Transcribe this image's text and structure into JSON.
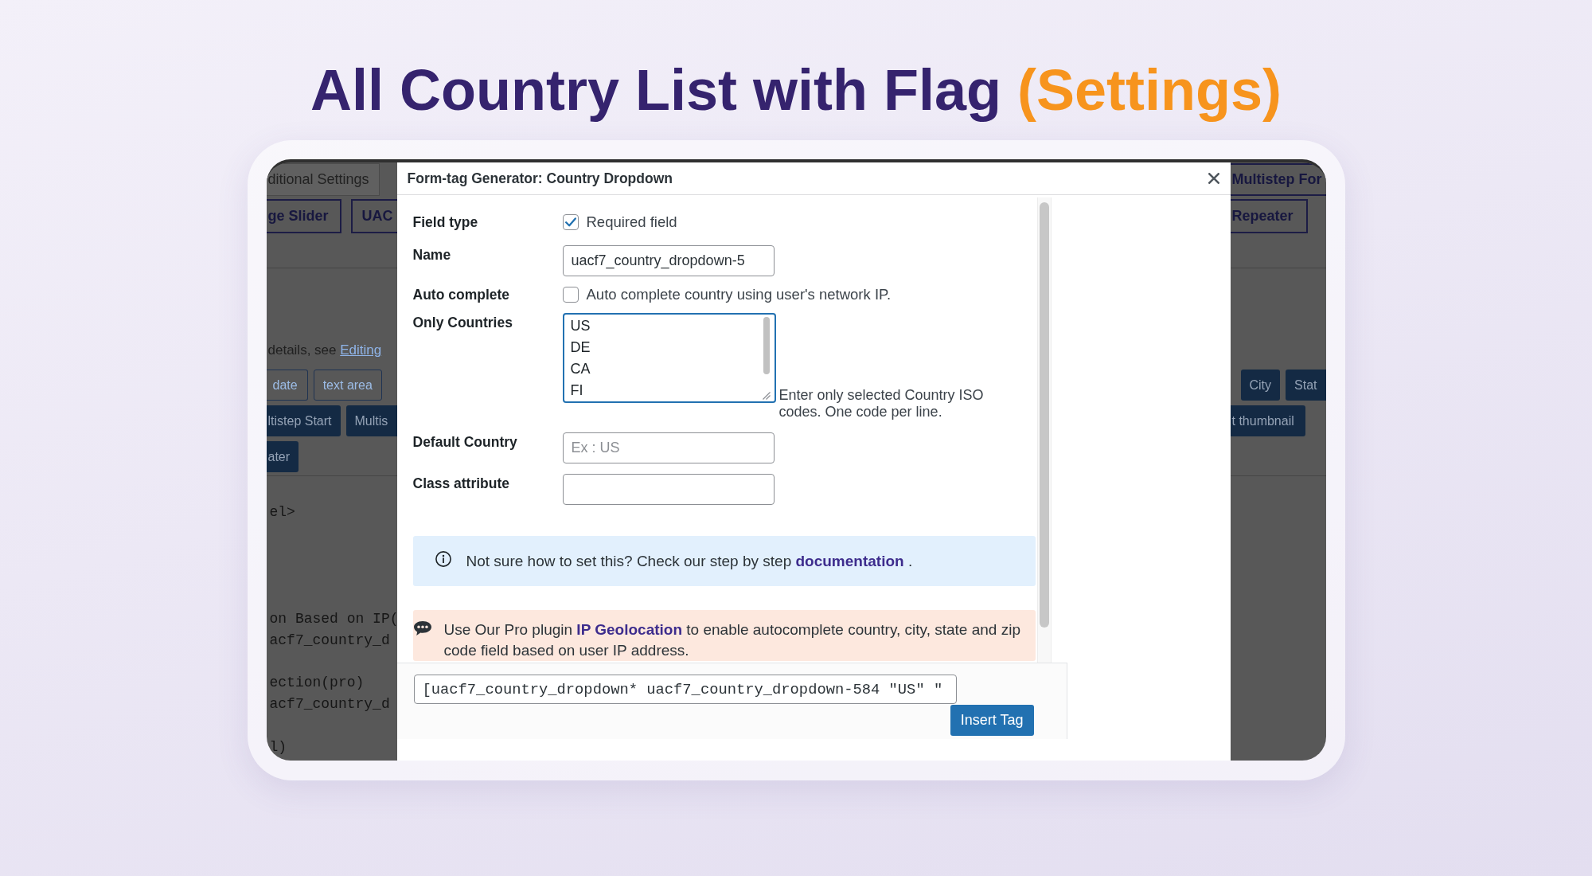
{
  "heading": {
    "text": "All Country List with Flag",
    "highlight": "(Settings)"
  },
  "backdrop": {
    "left": {
      "tabs": [
        {
          "label": "ditional Settings",
          "kind": "plain"
        }
      ],
      "buttons": [
        {
          "label": "ge Slider"
        },
        {
          "label": "UAC"
        }
      ],
      "note": {
        "text": "details, see",
        "link": "Editing"
      },
      "tag_rows": [
        [
          {
            "label": "date",
            "kind": "outline"
          },
          {
            "label": "text area",
            "kind": "outline"
          }
        ],
        [
          {
            "label": "ltistep Start",
            "kind": "filled"
          },
          {
            "label": "Multis",
            "kind": "filled"
          }
        ],
        [
          {
            "label": "ater",
            "kind": "filled"
          }
        ]
      ],
      "code": "el>\n\n\n\n\non Based on IP(\nacf7_country_d\n\nection(pro)\nacf7_country_d\n\nl)"
    },
    "right": {
      "tabs": [
        {
          "label": "Multistep For",
          "kind": "outlined"
        }
      ],
      "buttons": [
        {
          "label": "Repeater"
        }
      ],
      "tag_rows": [
        [
          {
            "label": "City",
            "kind": "filled"
          },
          {
            "label": "Stat",
            "kind": "filled"
          }
        ],
        [
          {
            "label": "t thumbnail",
            "kind": "filled"
          }
        ]
      ]
    }
  },
  "dialog": {
    "title": "Form-tag Generator: Country Dropdown",
    "fields": [
      {
        "kind": "checkbox",
        "label": "Field type",
        "option": "Required field",
        "checked": true
      },
      {
        "kind": "text",
        "label": "Name",
        "value": "uacf7_country_dropdown-5"
      },
      {
        "kind": "checkbox",
        "label": "Auto complete",
        "option": "Auto complete country using user's network IP.",
        "checked": false
      },
      {
        "kind": "textarea",
        "label": "Only Countries",
        "lines": [
          "US",
          "DE",
          "CA",
          "FI"
        ],
        "focused": true,
        "help": "Enter only selected Country ISO codes. One code per line."
      },
      {
        "kind": "text",
        "label": "Default Country",
        "placeholder": "Ex : US"
      },
      {
        "kind": "text",
        "label": "Class attribute"
      }
    ],
    "info": {
      "before": "Not sure how to set this? Check our step by step",
      "link": "documentation",
      "after": "."
    },
    "promo": {
      "before": "Use Our Pro plugin",
      "link": "IP Geolocation",
      "after": "to enable autocomplete country, city, state and zip code field based on user IP address."
    },
    "footer": {
      "tag": "[uacf7_country_dropdown* uacf7_country_dropdown-584 \"US\" \"",
      "button": "Insert Tag"
    }
  }
}
